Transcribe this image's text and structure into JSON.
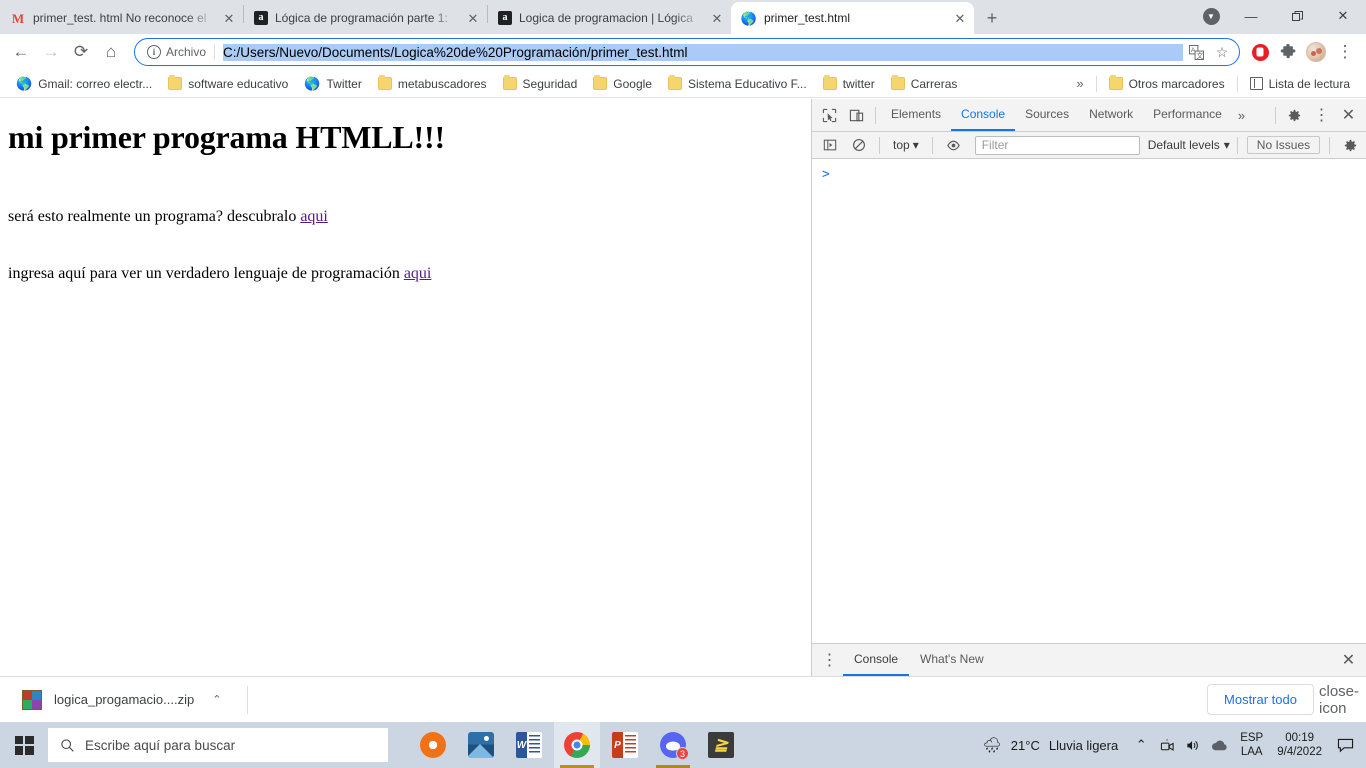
{
  "browser": {
    "tabs": [
      {
        "favicon": "gmail-icon",
        "title": "primer_test. html No reconoce el",
        "active": false
      },
      {
        "favicon": "anchor-icon",
        "title": "Lógica de programación parte 1:",
        "active": false
      },
      {
        "favicon": "anchor-icon",
        "title": "Logica de programacion | Lógica",
        "active": false
      },
      {
        "favicon": "globe-icon",
        "title": "primer_test.html",
        "active": true
      }
    ],
    "new_tab_label": "+",
    "window_controls": {
      "minimize": "—",
      "maximize": "❐",
      "close": "✕"
    },
    "toolbar": {
      "back": "←",
      "forward": "→",
      "reload": "⟳",
      "home": "⌂",
      "security_label": "Archivo",
      "url": "C:/Users/Nuevo/Documents/Logica%20de%20Programación/primer_test.html",
      "translate_icon": "translate-icon",
      "bookmark_icon": "star-icon",
      "adblock_icon": "adblock-icon",
      "extensions_icon": "puzzle-icon",
      "profile_icon": "avatar-icon",
      "menu_icon": "three-dots-icon"
    },
    "bookmarks": [
      {
        "icon": "globe-icon",
        "label": "Gmail: correo electr..."
      },
      {
        "icon": "folder-icon",
        "label": "software educativo"
      },
      {
        "icon": "globe-icon",
        "label": "Twitter"
      },
      {
        "icon": "folder-icon",
        "label": "metabuscadores"
      },
      {
        "icon": "folder-icon",
        "label": "Seguridad"
      },
      {
        "icon": "folder-icon",
        "label": "Google"
      },
      {
        "icon": "folder-icon",
        "label": "Sistema Educativo F..."
      },
      {
        "icon": "folder-icon",
        "label": "twitter"
      },
      {
        "icon": "folder-icon",
        "label": "Carreras"
      }
    ],
    "bookmarks_overflow": "»",
    "other_bookmarks": "Otros marcadores",
    "reading_list": "Lista de lectura"
  },
  "page": {
    "heading": "mi primer programa HTMLL!!!",
    "paragraph1_text": "será esto realmente un programa? descubralo ",
    "paragraph1_link": "aqui",
    "paragraph2_text": "ingresa aquí para ver un verdadero lenguaje de programación ",
    "paragraph2_link": "aqui"
  },
  "devtools": {
    "inspect_icon": "inspect-icon",
    "device_icon": "device-toolbar-icon",
    "tabs": [
      {
        "label": "Elements",
        "active": false
      },
      {
        "label": "Console",
        "active": true
      },
      {
        "label": "Sources",
        "active": false
      },
      {
        "label": "Network",
        "active": false
      },
      {
        "label": "Performance",
        "active": false
      }
    ],
    "more_tabs": "»",
    "settings_icon": "gear-icon",
    "menu_icon": "three-dots-icon",
    "close_icon": "close-icon",
    "console_toolbar": {
      "sidebar_icon": "console-sidebar-icon",
      "clear_icon": "clear-console-icon",
      "context": "top",
      "context_caret": "▾",
      "eye_icon": "live-expression-icon",
      "filter_placeholder": "Filter",
      "levels": "Default levels",
      "levels_caret": "▾",
      "issues": "No Issues",
      "settings_icon": "console-settings-icon"
    },
    "prompt": ">",
    "drawer": {
      "menu_icon": "three-dots-icon",
      "tabs": [
        {
          "label": "Console",
          "active": true
        },
        {
          "label": "What's New",
          "active": false
        }
      ],
      "close_icon": "close-icon"
    }
  },
  "downloads": {
    "file_icon": "zip-archive-icon",
    "file_name": "logica_progamacio....zip",
    "caret": "⌃",
    "show_all": "Mostrar todo",
    "close_icon": "close-icon"
  },
  "taskbar": {
    "start_icon": "windows-start-icon",
    "search_icon": "search-icon",
    "search_placeholder": "Escribe aquí para buscar",
    "apps": [
      {
        "name": "settings-orange-icon",
        "active": false,
        "running": false,
        "badge": null
      },
      {
        "name": "photos-icon",
        "active": false,
        "running": false,
        "badge": null
      },
      {
        "name": "word-icon",
        "active": false,
        "running": false,
        "badge": null
      },
      {
        "name": "chrome-icon",
        "active": true,
        "running": true,
        "badge": null
      },
      {
        "name": "powerpoint-icon",
        "active": false,
        "running": false,
        "badge": null
      },
      {
        "name": "discord-icon",
        "active": false,
        "running": true,
        "badge": "3"
      },
      {
        "name": "sublime-text-icon",
        "active": false,
        "running": false,
        "badge": null
      }
    ],
    "tray": {
      "weather_icon": "rain-cloud-icon",
      "temperature": "21°C",
      "condition": "Lluvia ligera",
      "overflow_caret": "⌃",
      "meet_icon": "camera-icon",
      "volume_icon": "speaker-icon",
      "onedrive_icon": "cloud-icon",
      "lang_top": "ESP",
      "lang_bottom": "LAA",
      "time": "00:19",
      "date": "9/4/2022",
      "notification_icon": "notification-icon"
    }
  },
  "colors": {
    "accent_blue": "#1a73e8",
    "tabstrip_bg": "#dee1e6",
    "taskbar_bg": "#cbd6e2",
    "link_purple": "#551a8b",
    "selection_blue": "#aacbf5"
  }
}
